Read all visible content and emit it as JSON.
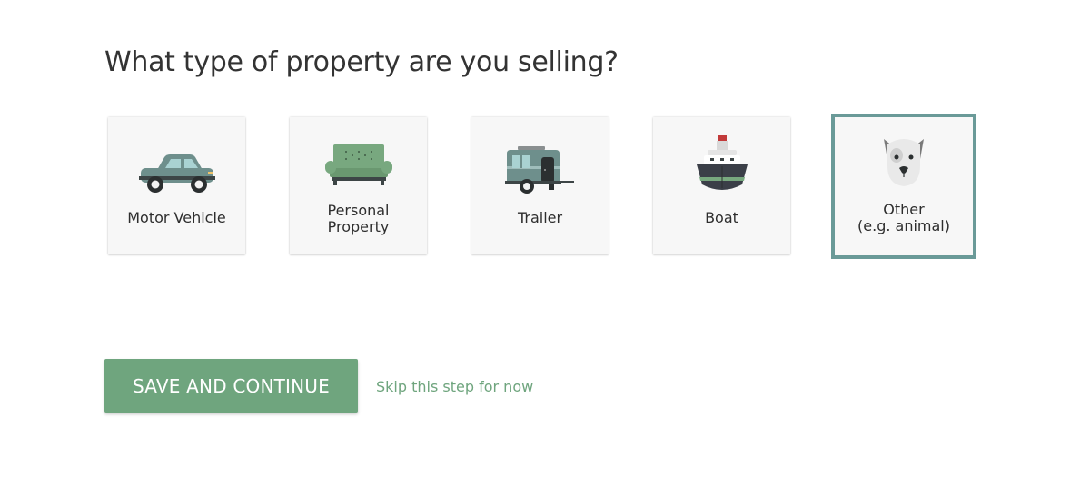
{
  "question": "What type of property are you selling?",
  "options": [
    {
      "lines": [
        "Motor Vehicle"
      ],
      "icon": "car-icon",
      "selected": false
    },
    {
      "lines": [
        "Personal",
        "Property"
      ],
      "icon": "sofa-icon",
      "selected": false
    },
    {
      "lines": [
        "Trailer"
      ],
      "icon": "trailer-icon",
      "selected": false
    },
    {
      "lines": [
        "Boat"
      ],
      "icon": "boat-icon",
      "selected": false
    },
    {
      "lines": [
        "Other",
        "(e.g. animal)"
      ],
      "icon": "dog-icon",
      "selected": true
    }
  ],
  "actions": {
    "save_label": "SAVE AND CONTINUE",
    "skip_label": "Skip this step for now"
  },
  "colors": {
    "accent_green": "#6fa57e",
    "selected_border": "#6a9a98"
  }
}
